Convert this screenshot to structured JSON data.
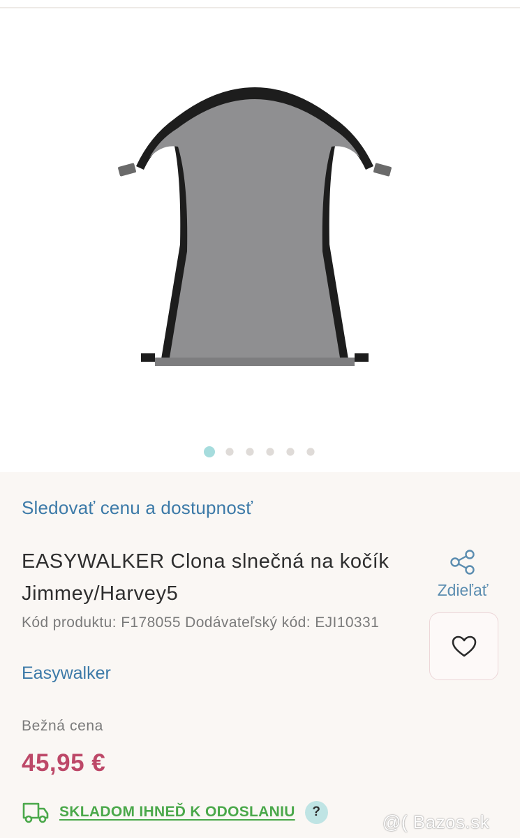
{
  "gallery": {
    "image_alt": "Clona slnečná",
    "slides_total": 6,
    "active_slide": 1
  },
  "product": {
    "track_link": "Sledovať cenu a dostupnosť",
    "title": "EASYWALKER Clona slnečná na kočík Jimmey/Harvey5",
    "codes": "Kód produktu: F178055 Dodávateľský kód: EJI10331",
    "brand": "Easywalker",
    "share_label": "Zdieľať",
    "regular_price_label": "Bežná cena",
    "price": "45,95 €",
    "stock_status": "SKLADOM IHNEĎ K ODOSLANIU",
    "help_symbol": "?"
  },
  "watermark": "@( Bazos.sk",
  "colors": {
    "link": "#3c7aa8",
    "price": "#bd4868",
    "stock": "#4aa84a",
    "dot_active": "#a6dcdd"
  },
  "icons": {
    "share": "share-icon",
    "wishlist": "heart-icon",
    "delivery": "truck-icon",
    "help": "help-icon"
  }
}
